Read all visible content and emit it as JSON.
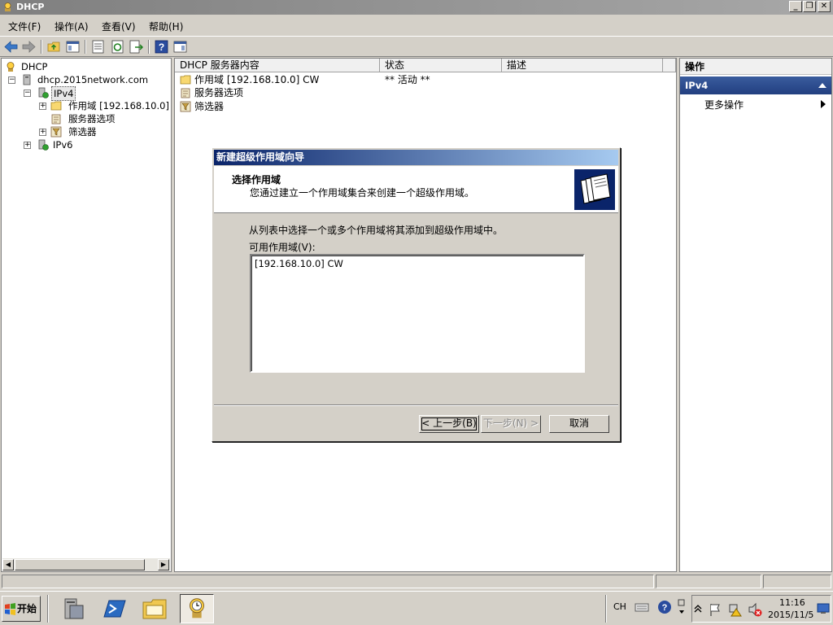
{
  "window": {
    "title": "DHCP",
    "minimize_label": "_",
    "restore_label": "❐",
    "close_label": "✕"
  },
  "menu": {
    "items": [
      "文件(F)",
      "操作(A)",
      "查看(V)",
      "帮助(H)"
    ]
  },
  "tree": {
    "root": "DHCP",
    "server": "dhcp.2015network.com",
    "ipv4": "IPv4",
    "scope": "作用域 [192.168.10.0]",
    "server_options": "服务器选项",
    "filters": "筛选器",
    "ipv6": "IPv6"
  },
  "content": {
    "columns": [
      "DHCP 服务器内容",
      "状态",
      "描述"
    ],
    "rows": [
      {
        "name": "作用域 [192.168.10.0] CW",
        "status": "** 活动 **"
      },
      {
        "name": "服务器选项",
        "status": ""
      },
      {
        "name": "筛选器",
        "status": ""
      }
    ]
  },
  "actions": {
    "title": "操作",
    "section": "IPv4",
    "more": "更多操作"
  },
  "dialog": {
    "title": "新建超级作用域向导",
    "header_title": "选择作用域",
    "header_desc": "您通过建立一个作用域集合来创建一个超级作用域。",
    "instruction": "从列表中选择一个或多个作用域将其添加到超级作用域中。",
    "list_label": "可用作用域(V):",
    "list_items": [
      "[192.168.10.0] CW"
    ],
    "back_button": "< 上一步(B)",
    "next_button": "下一步(N) >",
    "cancel_button": "取消"
  },
  "taskbar": {
    "start": "开始",
    "lang": "CH",
    "time": "11:16",
    "date": "2015/11/5"
  }
}
